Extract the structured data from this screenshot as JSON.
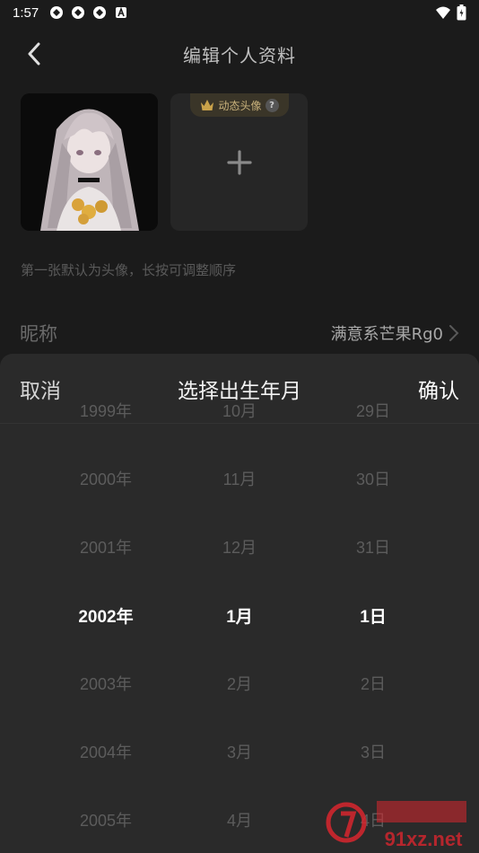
{
  "status": {
    "time": "1:57",
    "notification_icons": [
      "app-icon",
      "app-icon",
      "app-icon",
      "letter-a-icon"
    ],
    "right_icons": [
      "wifi-icon",
      "battery-icon"
    ]
  },
  "header": {
    "title": "编辑个人资料"
  },
  "avatars": {
    "dynamic_badge_label": "动态头像",
    "help_glyph": "?",
    "add_glyph": "+"
  },
  "hint": "第一张默认为头像，长按可调整顺序",
  "nickname": {
    "label": "昵称",
    "value": "满意系芒果Rg0"
  },
  "picker": {
    "cancel_label": "取消",
    "title": "选择出生年月",
    "confirm_label": "确认",
    "years": [
      "1999年",
      "2000年",
      "2001年",
      "2002年",
      "2003年",
      "2004年",
      "2005年"
    ],
    "months": [
      "10月",
      "11月",
      "12月",
      "1月",
      "2月",
      "3月",
      "4月"
    ],
    "days": [
      "29日",
      "30日",
      "31日",
      "1日",
      "2日",
      "3日",
      "4日"
    ],
    "selected_index": 3
  },
  "watermark": {
    "text": "91xz.net"
  },
  "colors": {
    "background": "#1b1b1b",
    "sheet": "#2a2a2a",
    "badge_text": "#c9b27c",
    "watermark_red": "#d8262e"
  }
}
